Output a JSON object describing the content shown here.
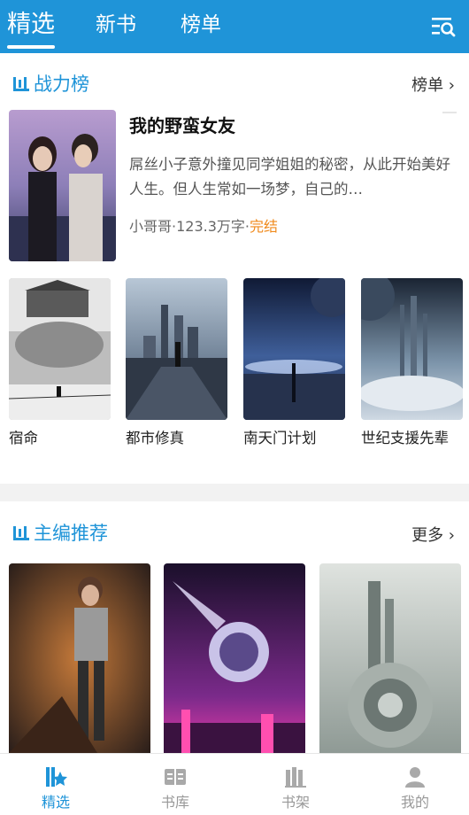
{
  "header": {
    "tabs": [
      {
        "label": "精选",
        "active": true
      },
      {
        "label": "新书",
        "active": false
      },
      {
        "label": "榜单",
        "active": false
      }
    ],
    "search_icon": "search-list-icon"
  },
  "ranking": {
    "title": "战力榜",
    "more_label": "榜单 ›",
    "featured": {
      "title": "我的野蛮女友",
      "description": "屌丝小子意外撞见同学姐姐的秘密，从此开始美好人生。但人生常如一场梦，自己的…",
      "author": "小哥哥",
      "words": "123.3万字",
      "status": "完结",
      "meta_sep": "·"
    },
    "books": [
      {
        "name": "宿命"
      },
      {
        "name": "都市修真"
      },
      {
        "name": "南天门计划"
      },
      {
        "name": "世纪支援先辈"
      }
    ]
  },
  "editor": {
    "title": "主编推荐",
    "more_label": "更多 ›"
  },
  "bottom_nav": {
    "items": [
      {
        "label": "精选",
        "icon": "featured-icon",
        "active": true
      },
      {
        "label": "书库",
        "icon": "library-icon",
        "active": false
      },
      {
        "label": "书架",
        "icon": "bookshelf-icon",
        "active": false
      },
      {
        "label": "我的",
        "icon": "profile-icon",
        "active": false
      }
    ]
  },
  "colors": {
    "accent": "#1f94d8",
    "status_finished": "#f08a1c"
  }
}
